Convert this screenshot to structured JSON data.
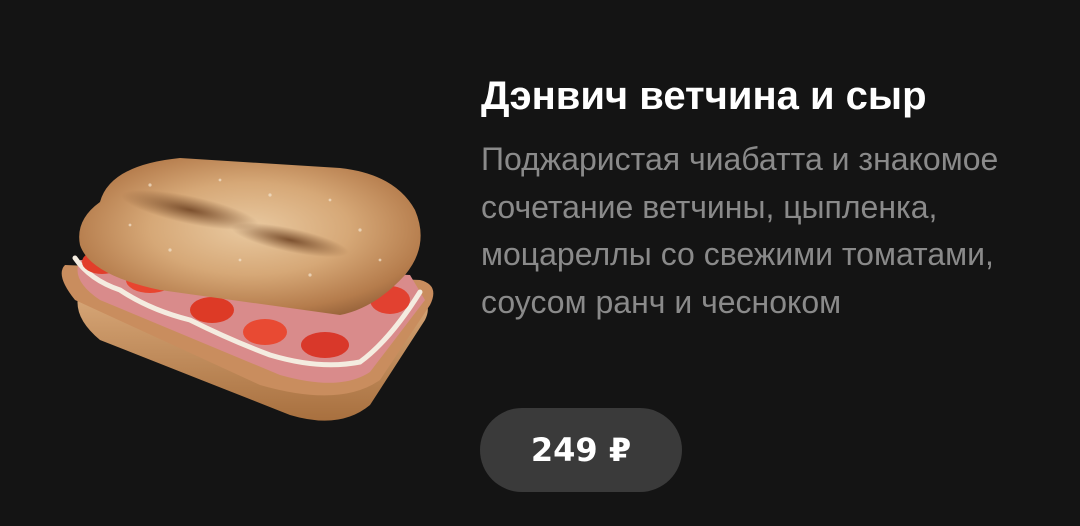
{
  "product": {
    "title": "Дэнвич ветчина и сыр",
    "description": "Поджаристая чиабатта и знакомое сочетание ветчины, цыпленка, моцареллы со свежими томатами, соусом ранч и чесноком",
    "price": "249 ₽"
  },
  "colors": {
    "background": "#141414",
    "title": "#ffffff",
    "description": "#8a8a8a",
    "price_button": "#3a3a3a"
  }
}
